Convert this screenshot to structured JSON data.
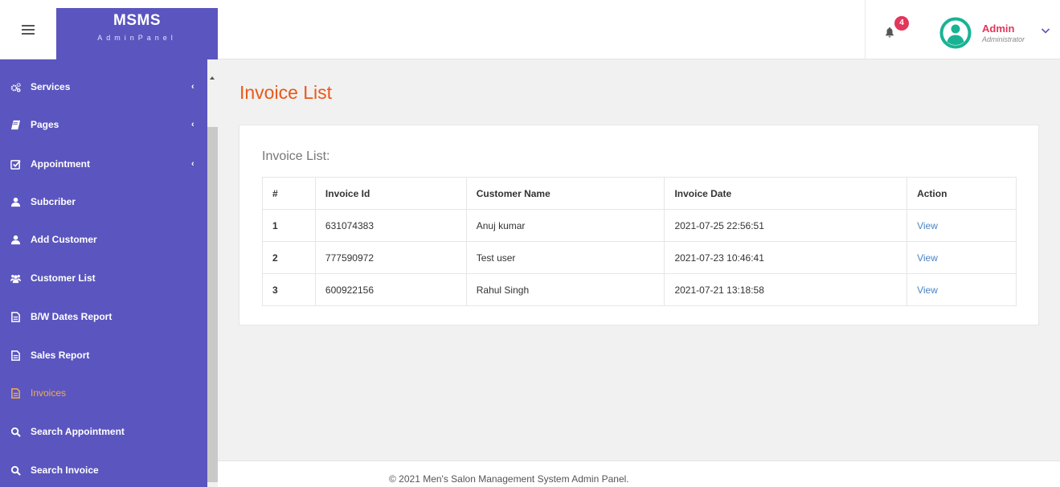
{
  "brand": {
    "name": "MSMS",
    "subtitle": "AdminPanel"
  },
  "header": {
    "notification_count": "4",
    "user_name": "Admin",
    "user_role": "Administrator"
  },
  "sidebar": {
    "items": [
      {
        "label": "Services",
        "icon": "cogs-icon",
        "caret": "‹"
      },
      {
        "label": "Pages",
        "icon": "book-icon",
        "caret": "‹"
      },
      {
        "label": "Appointment",
        "icon": "check-square-icon",
        "caret": "‹"
      },
      {
        "label": "Subcriber",
        "icon": "user-icon"
      },
      {
        "label": "Add Customer",
        "icon": "user-icon"
      },
      {
        "label": "Customer List",
        "icon": "users-icon"
      },
      {
        "label": "B/W Dates Report",
        "icon": "file-icon"
      },
      {
        "label": "Sales Report",
        "icon": "file-icon"
      },
      {
        "label": "Invoices",
        "icon": "file-icon",
        "active": true
      },
      {
        "label": "Search Appointment",
        "icon": "search-icon"
      },
      {
        "label": "Search Invoice",
        "icon": "search-icon"
      }
    ]
  },
  "main": {
    "page_title": "Invoice List",
    "card_title": "Invoice List:",
    "table": {
      "headers": [
        "#",
        "Invoice Id",
        "Customer Name",
        "Invoice Date",
        "Action"
      ],
      "rows": [
        {
          "num": "1",
          "invoice_id": "631074383",
          "customer": "Anuj kumar",
          "date": "2021-07-25 22:56:51",
          "action": "View"
        },
        {
          "num": "2",
          "invoice_id": "777590972",
          "customer": "Test user",
          "date": "2021-07-23 10:46:41",
          "action": "View"
        },
        {
          "num": "3",
          "invoice_id": "600922156",
          "customer": "Rahul Singh",
          "date": "2021-07-21 13:18:58",
          "action": "View"
        }
      ]
    }
  },
  "footer": {
    "text": "© 2021 Men's Salon Management System Admin Panel."
  },
  "colors": {
    "sidebar": "#5b55bf",
    "accent": "#e8591a",
    "active": "#f0ad4e",
    "link": "#4a84c4",
    "badge": "#e2365b",
    "avatar": "#19b394"
  }
}
